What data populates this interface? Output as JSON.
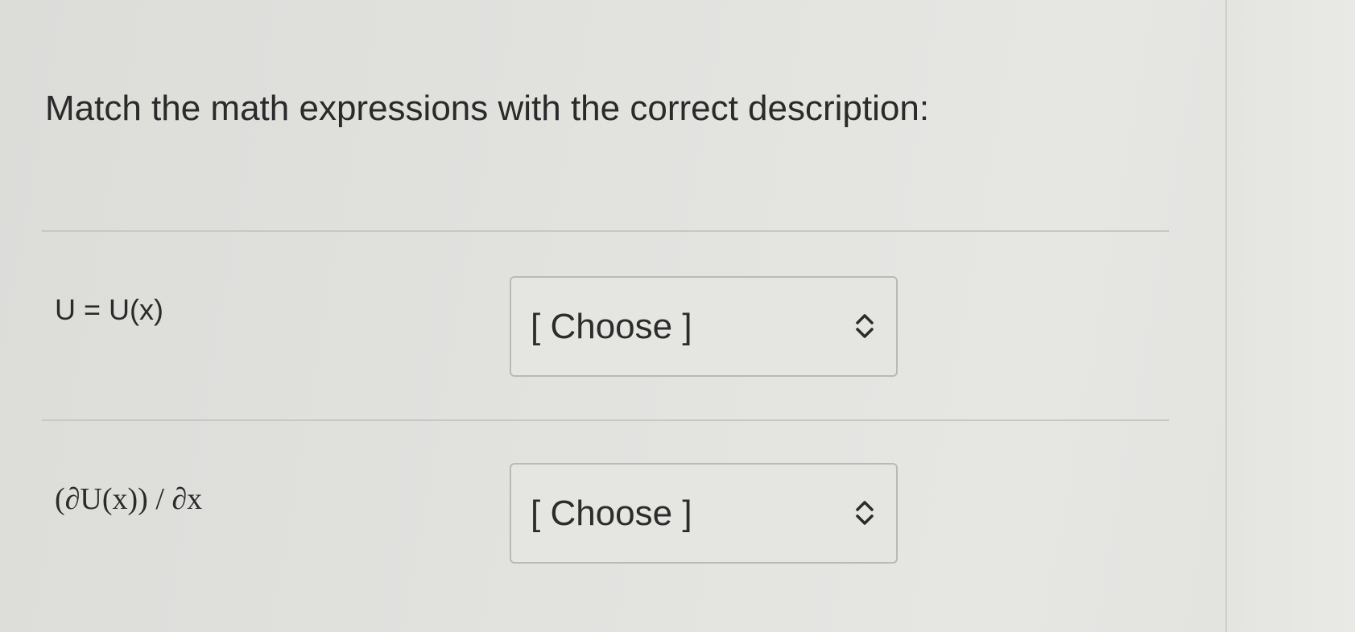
{
  "question": {
    "prompt": "Match the math expressions with the correct description:"
  },
  "pairs": [
    {
      "expression": "U = U(x)",
      "select_value": "[ Choose ]"
    },
    {
      "expression": "(∂U(x)) / ∂x",
      "select_value": "[ Choose ]"
    }
  ],
  "icons": {
    "select_arrows": "up-down-chevron-icon"
  },
  "colors": {
    "background": "#e2e2df",
    "text": "#2b2b2b",
    "border": "#b9b9b6"
  }
}
